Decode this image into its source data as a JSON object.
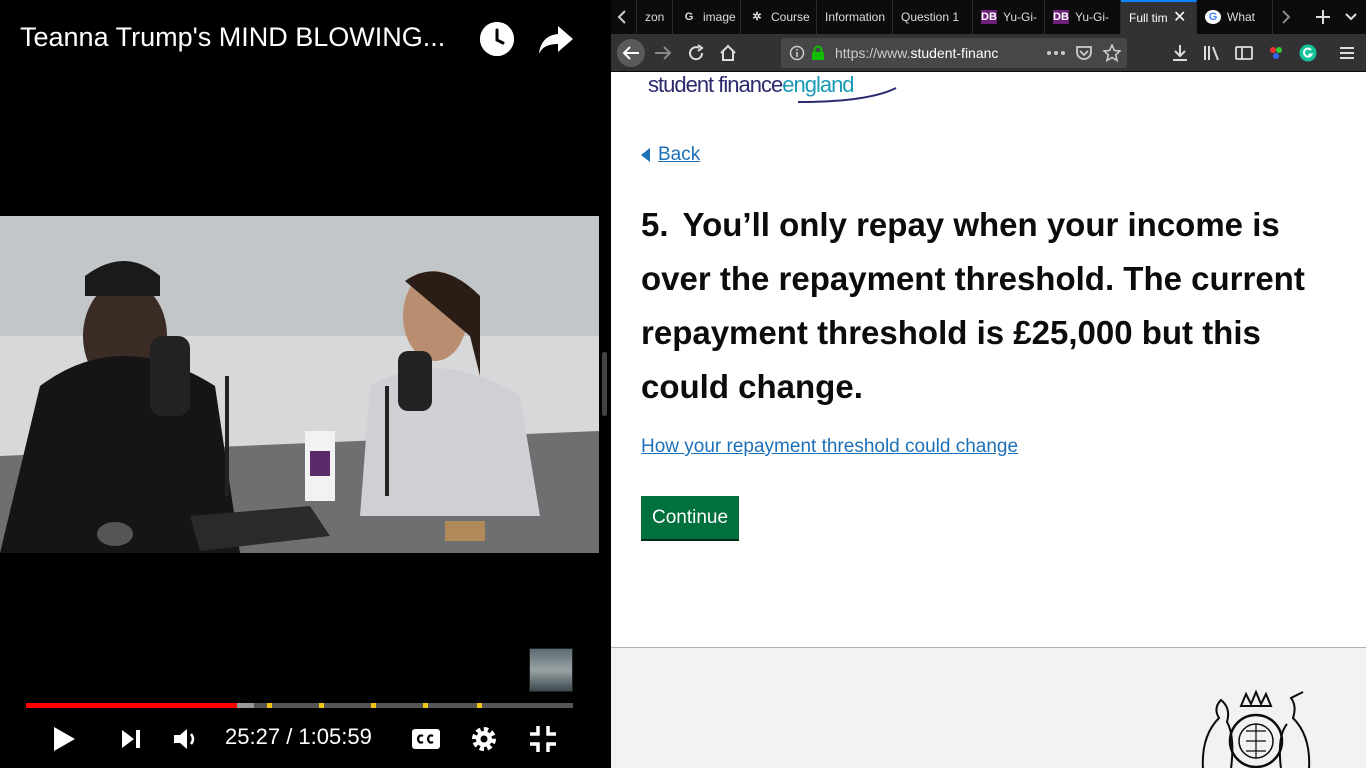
{
  "video": {
    "title": "Teanna Trump's MIND BLOWING...",
    "time_current": "25:27",
    "time_total": "1:05:59",
    "progress_played": 0.386,
    "progress_buffered": 0.417,
    "chapter_marks": [
      0.441,
      0.536,
      0.631,
      0.726,
      0.825
    ]
  },
  "browser": {
    "tabs": [
      {
        "label": "zon",
        "favicon": ""
      },
      {
        "label": "image",
        "favicon": "G"
      },
      {
        "label": "Course",
        "favicon": "✲"
      },
      {
        "label": "Information",
        "favicon": ""
      },
      {
        "label": "Question 1",
        "favicon": ""
      },
      {
        "label": "Yu-Gi-",
        "favicon": "DB"
      },
      {
        "label": "Yu-Gi-",
        "favicon": "DB"
      },
      {
        "label": "Full tim",
        "favicon": ""
      },
      {
        "label": "What",
        "favicon": "G"
      }
    ],
    "url_prefix": "https://www.",
    "url_domain": "student-financ"
  },
  "page": {
    "logo_part1": "student finance",
    "logo_part2": "england",
    "back_label": "Back",
    "question_number": "5.",
    "question_text": "You’ll only repay when your income is over the repayment threshold. The current repayment threshold is £25,000 but this could change.",
    "threshold_link": "How your repayment threshold could change",
    "continue_label": "Continue"
  }
}
